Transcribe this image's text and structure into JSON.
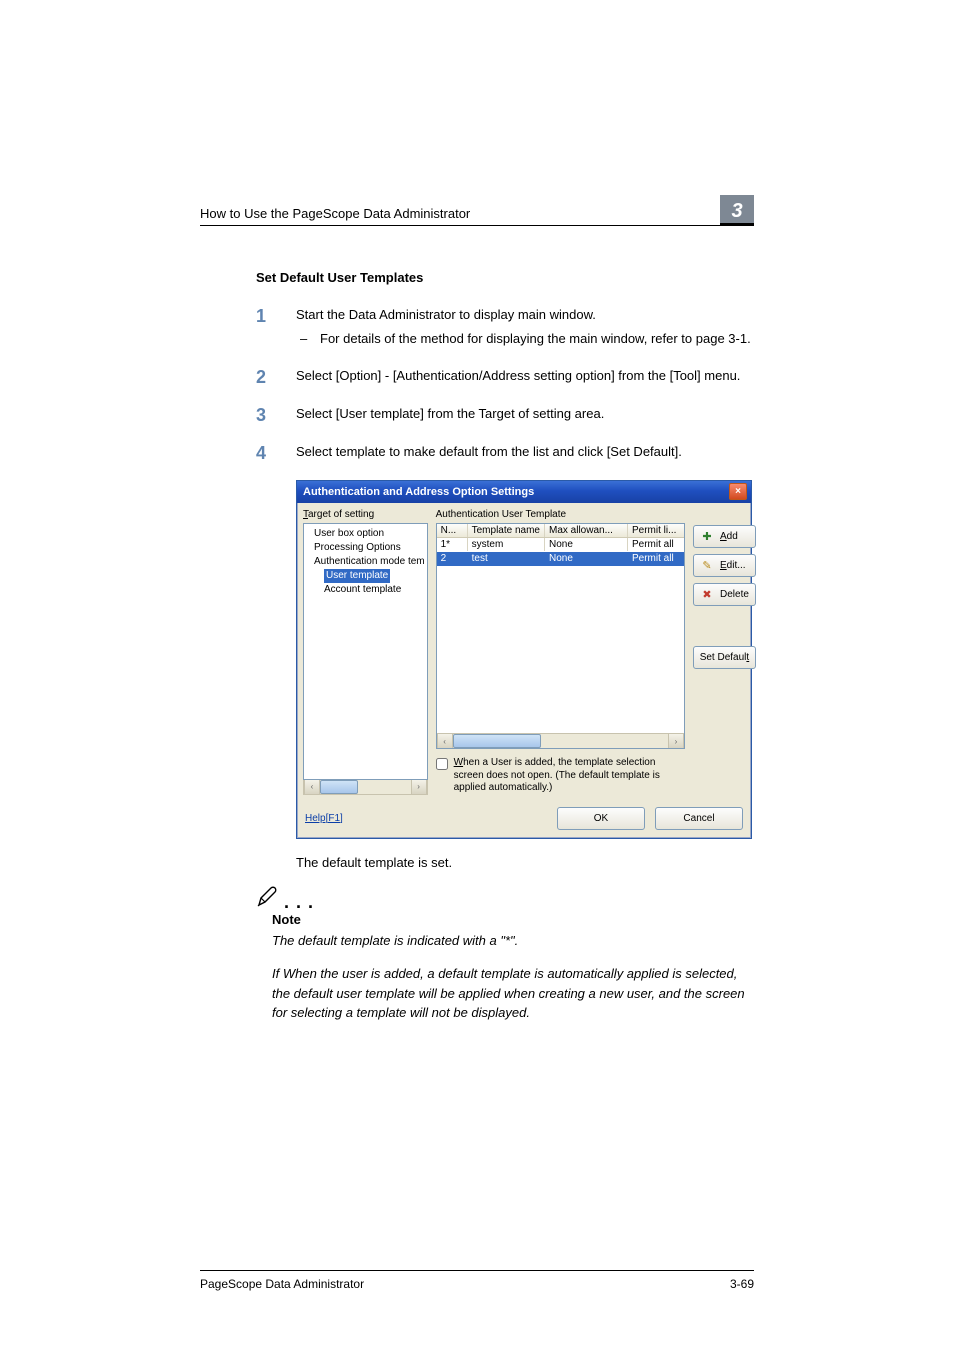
{
  "header": {
    "running_head": "How to Use the PageScope Data Administrator",
    "chapter_number": "3"
  },
  "section": {
    "heading": "Set Default User Templates"
  },
  "steps": {
    "s1": "Start the Data Administrator to display main window.",
    "s1_sub": "For details of the method for displaying the main window, refer to page 3-1.",
    "s2": "Select [Option] - [Authentication/Address setting option] from the [Tool] menu.",
    "s3": "Select [User template] from the Target of setting area.",
    "s4": "Select template to make default from the list and click [Set Default]."
  },
  "dialog": {
    "title": "Authentication and Address Option Settings",
    "close_glyph": "×",
    "tree_label_pre": "T",
    "tree_label_post": "arget of setting",
    "tree_items": {
      "user_box": "User box option",
      "processing": "Processing Options",
      "auth_mode": "Authentication mode tem",
      "user_template": "User template",
      "account_template": "Account template"
    },
    "center_title": "Authentication User Template",
    "columns": {
      "n": "N...",
      "name": "Template name",
      "max": "Max allowan...",
      "permit": "Permit li..."
    },
    "rows": [
      {
        "n": "1*",
        "name": "system",
        "max": "None",
        "permit": "Permit all"
      },
      {
        "n": "2",
        "name": "test",
        "max": "None",
        "permit": "Permit all"
      }
    ],
    "checkbox_pre": "W",
    "checkbox_text": "hen a User is added, the template selection screen does not open. (The default template is applied automatically.)",
    "buttons": {
      "add_pre": "A",
      "add_post": "dd",
      "edit_pre": "E",
      "edit_post": "dit...",
      "delete": "Delete",
      "set_default_pre": "",
      "set_default": "Set Default",
      "set_default_ul": "t",
      "ok": "OK",
      "cancel": "Cancel"
    },
    "help": "Help[F1]",
    "scroll": {
      "left": "‹",
      "right": "›"
    }
  },
  "caption": "The default template is set.",
  "note": {
    "label": "Note",
    "body1": "The default template is indicated with a \"*\".",
    "body2": "If When the user is added, a default template is automatically applied is selected, the default user template will be applied when creating a new user, and the screen for selecting a template will not be displayed."
  },
  "footer": {
    "left": "PageScope Data Administrator",
    "right": "3-69"
  }
}
